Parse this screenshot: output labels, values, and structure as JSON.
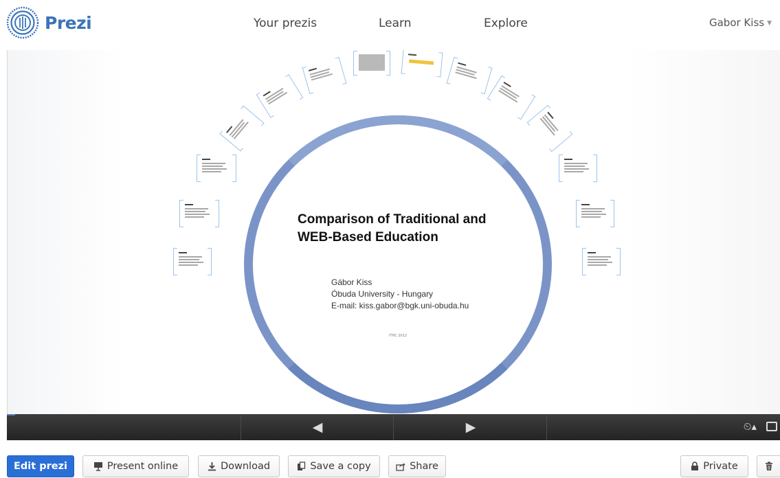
{
  "header": {
    "logo_text": "Prezi",
    "nav": [
      "Your prezis",
      "Learn",
      "Explore"
    ],
    "user": "Gabor Kiss",
    "logo_icon": "prezi-logo-icon"
  },
  "slide": {
    "title_line1": "Comparison of Traditional and",
    "title_line2": "WEB-Based Education",
    "author": "Gábor Kiss",
    "affiliation": "Óbuda University - Hungary",
    "email": "E-mail: kiss.gabor@bgk.uni-obuda.hu",
    "footer": "ITHC 2012",
    "ring_color": "#7b94c8"
  },
  "player": {
    "prev_icon": "arrow-left-icon",
    "next_icon": "arrow-right-icon",
    "autoplay_icon": "autoplay-icon",
    "fullscreen_icon": "fullscreen-icon",
    "prev_glyph": "◀",
    "next_glyph": "▶",
    "autoplay_glyph": "⏲▴"
  },
  "toolbar": {
    "edit": "Edit prezi",
    "present": "Present online",
    "download": "Download",
    "save_copy": "Save a copy",
    "share": "Share",
    "private": "Private",
    "accent": "#2a6fd6"
  }
}
